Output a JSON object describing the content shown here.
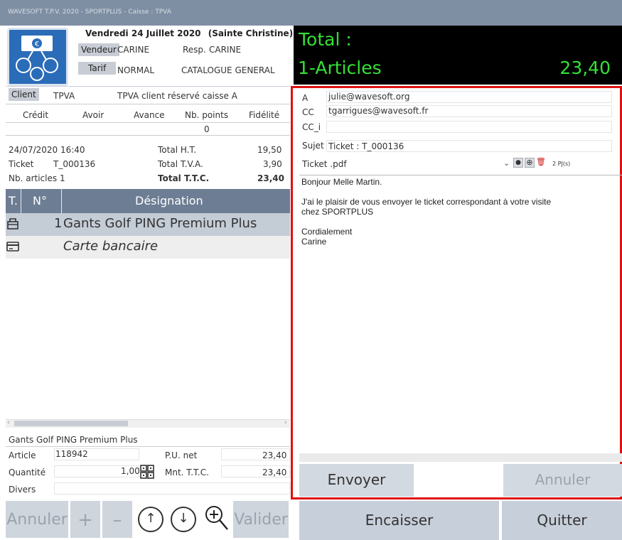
{
  "window": {
    "title": "WAVESOFT T.P.V. 2020 - SPORTPLUS - Caisse : TPVA"
  },
  "header": {
    "date": "Vendredi 24 Juillet 2020",
    "saint": "(Sainte Christine)",
    "vendeur_label": "Vendeur",
    "vendeur_value": "CARINE",
    "resp_label": "Resp.",
    "resp_value": "CARINE",
    "tarif_label": "Tarif",
    "tarif_value": "NORMAL",
    "catalogue": "CATALOGUE GENERAL"
  },
  "total_panel": {
    "total_label": "Total :",
    "articles_label": "1-Articles",
    "amount": "23,40"
  },
  "client": {
    "label": "Client",
    "code": "TPVA",
    "description": "TPVA client réservé caisse A",
    "columns": [
      "Crédit",
      "Avoir",
      "Avance",
      "Nb. points",
      "Fidélité"
    ],
    "values": [
      "",
      "",
      "",
      "0",
      ""
    ]
  },
  "ticket_info": {
    "datetime": "24/07/2020 16:40",
    "ticket_label": "Ticket",
    "ticket_value": "T_000136",
    "nb_articles_label": "Nb. articles",
    "nb_articles_value": "1",
    "total_ht_label": "Total H.T.",
    "total_ht_value": "19,50",
    "total_tva_label": "Total T.V.A.",
    "total_tva_value": "3,90",
    "total_ttc_label": "Total T.T.C.",
    "total_ttc_value": "23,40"
  },
  "grid": {
    "col_type": "T.",
    "col_num": "N°",
    "col_designation": "Désignation",
    "rows": [
      {
        "num": "1",
        "designation": "Gants Golf PING Premium Plus",
        "icon": "shopping-basket-icon"
      },
      {
        "num": "",
        "designation": "Carte bancaire",
        "icon": "credit-card-icon"
      }
    ]
  },
  "detail": {
    "product_name": "Gants Golf PING Premium Plus",
    "article_label": "Article",
    "article_value": "118942",
    "pu_net_label": "P.U. net",
    "pu_net_value": "23,40",
    "quantite_label": "Quantité",
    "quantite_value": "1,00",
    "mnt_ttc_label": "Mnt. T.T.C.",
    "mnt_ttc_value": "23,40",
    "divers_label": "Divers",
    "divers_value": ""
  },
  "keypad": {
    "annuler": "Annuler",
    "plus": "+",
    "minus": "–",
    "up": "↑",
    "down": "↓",
    "zoom": "⊕",
    "valider": "Valider"
  },
  "email": {
    "to_label": "A",
    "to_value": "julie@wavesoft.org",
    "cc_label": "CC",
    "cc_value": "tgarrigues@wavesoft.fr",
    "cci_label": "CC_i",
    "cci_value": "",
    "subject_label": "Sujet",
    "subject_value": "Ticket : T_000136",
    "attachment": "Ticket .pdf",
    "attachment_count": "2 PJ(s)",
    "body_line1": "Bonjour Melle Martin.",
    "body_line2": "J'ai le plaisir de vous envoyer le ticket correspondant à votre visite",
    "body_line3": "chez SPORTPLUS",
    "body_line4": "Cordialement",
    "body_line5": "Carine",
    "send_label": "Envoyer",
    "cancel_label": "Annuler"
  },
  "footer": {
    "encaisser": "Encaisser",
    "quitter": "Quitter"
  }
}
